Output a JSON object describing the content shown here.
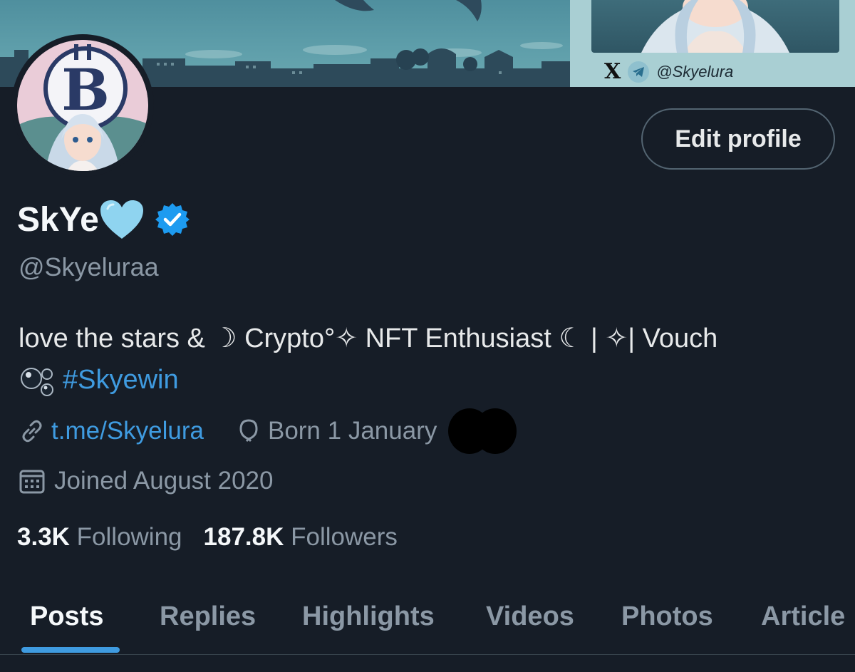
{
  "banner": {
    "x_logo": "X",
    "handle": "@Skyelura"
  },
  "profile": {
    "display_name": "SkYe",
    "handle": "@Skyeluraa",
    "edit_button_label": "Edit profile",
    "bio_text": "love the stars & ☽ Crypto°✧ NFT Enthusiast ☾ | ✧| Vouch",
    "bio_hashtag": "#Skyewin",
    "link": "t.me/Skyelura",
    "birthday": "Born 1 January",
    "joined": "Joined August 2020",
    "following_count": "3.3K",
    "following_label": "Following",
    "followers_count": "187.8K",
    "followers_label": "Followers"
  },
  "tabs": [
    {
      "label": "Posts",
      "active": true
    },
    {
      "label": "Replies",
      "active": false
    },
    {
      "label": "Highlights",
      "active": false
    },
    {
      "label": "Videos",
      "active": false
    },
    {
      "label": "Photos",
      "active": false
    },
    {
      "label": "Article",
      "active": false
    }
  ],
  "colors": {
    "background": "#161d27",
    "accent": "#3f9be0",
    "muted_text": "#8b98a5",
    "primary_text": "#e7e9ea"
  },
  "icons": {
    "heart": "light-blue-heart-icon",
    "verified": "verified-badge-icon",
    "link": "link-icon",
    "birthday": "balloon-icon",
    "joined": "calendar-icon",
    "bubbles": "bubbles-icon"
  }
}
